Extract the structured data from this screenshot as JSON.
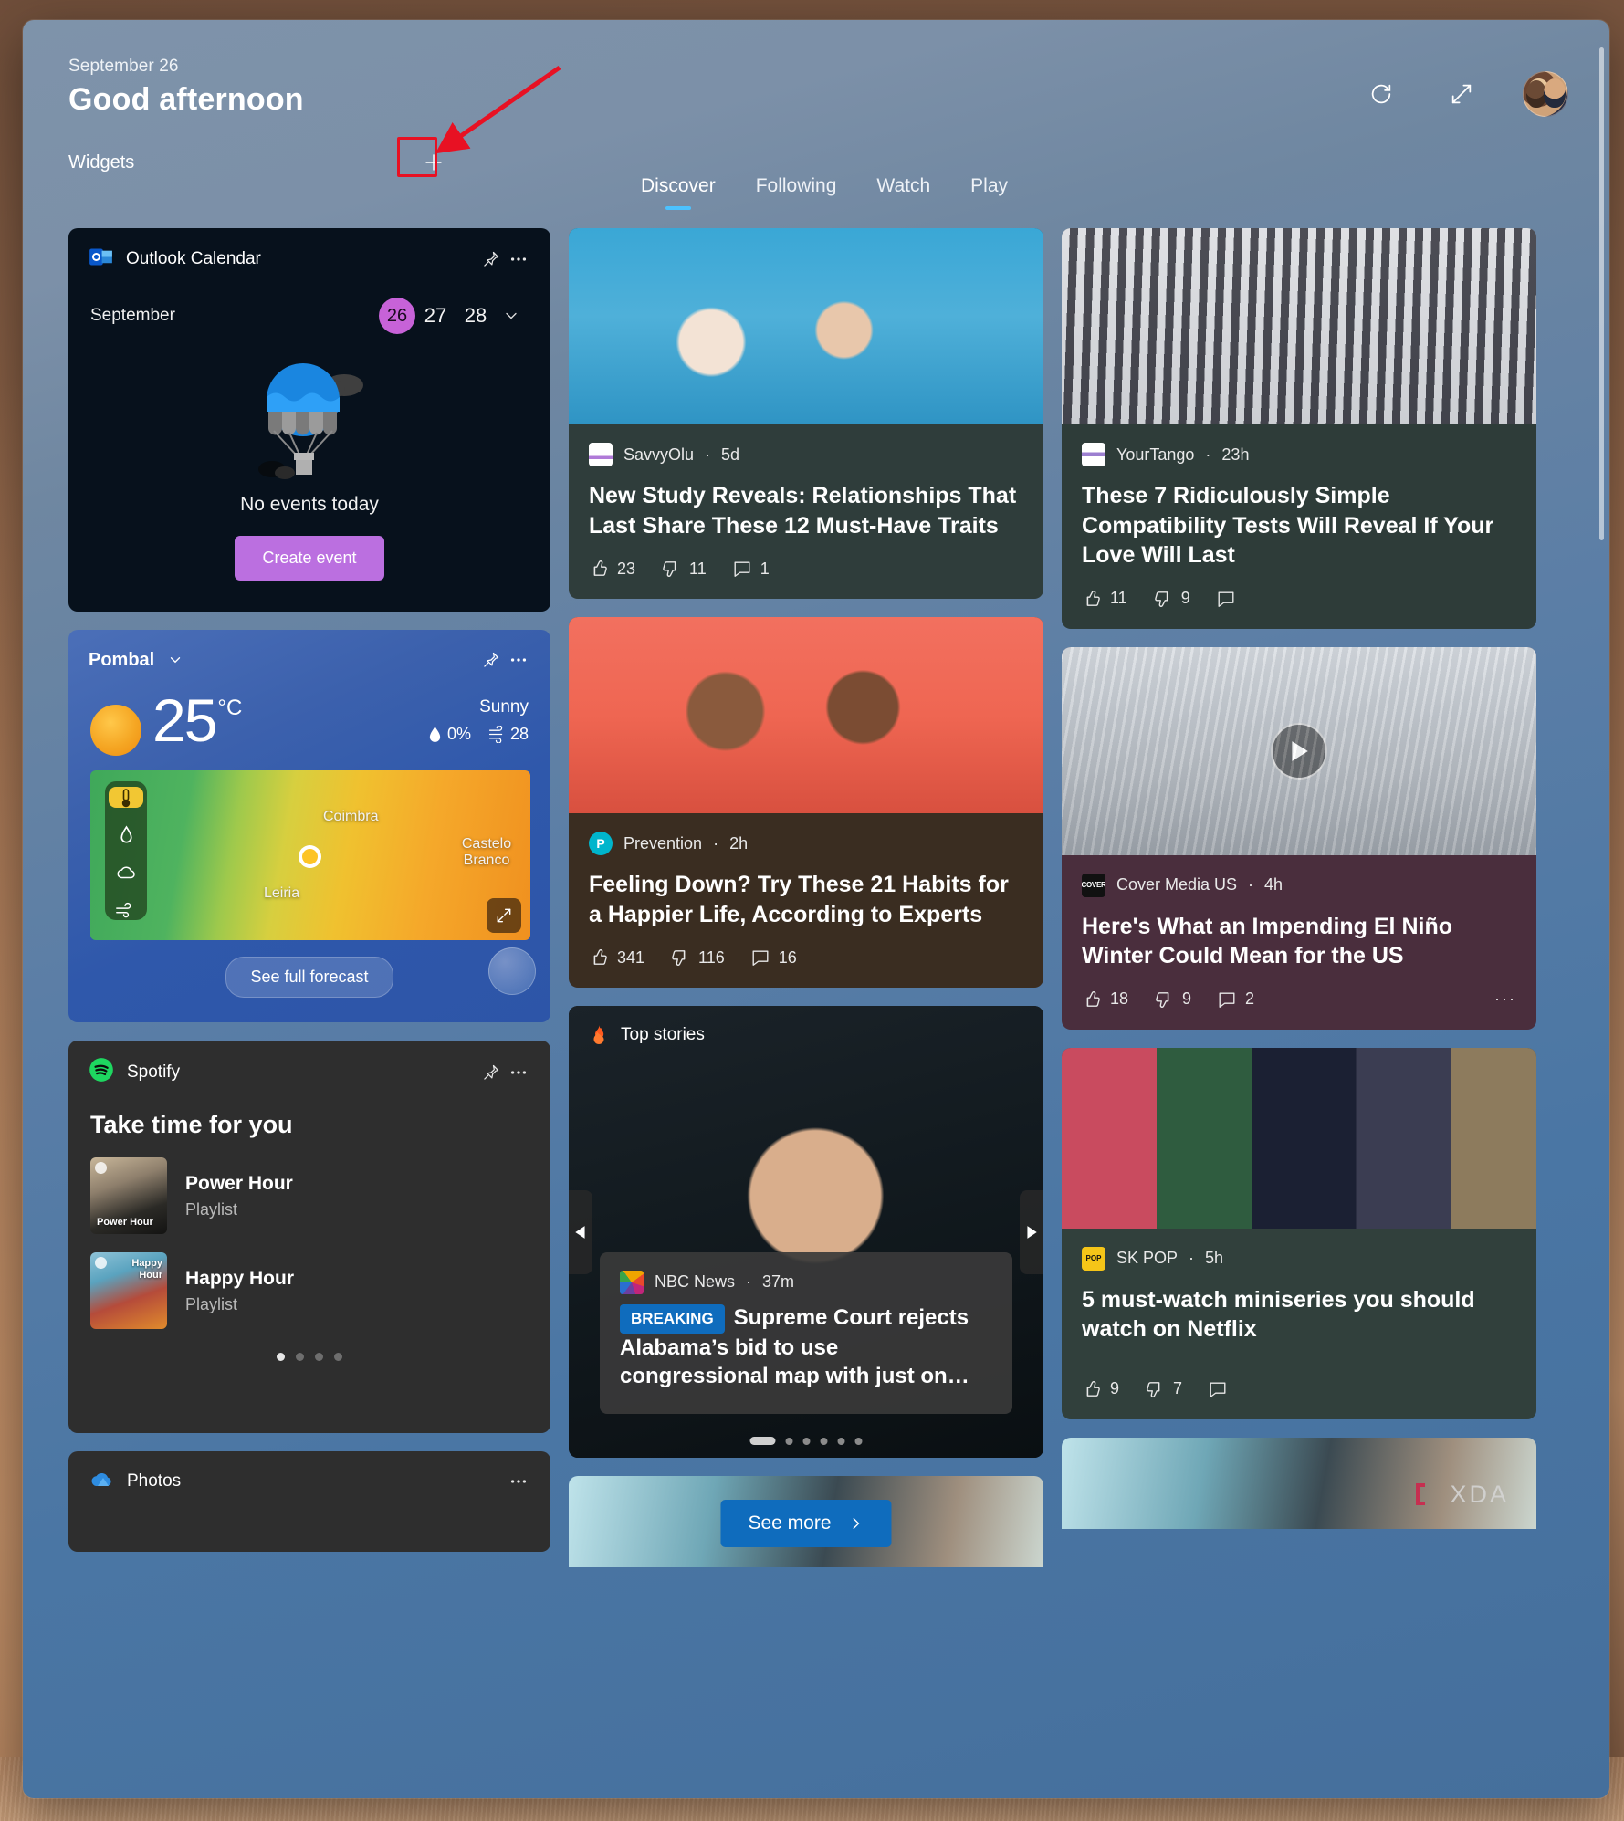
{
  "header": {
    "date": "September 26",
    "greeting": "Good afternoon",
    "widgets_label": "Widgets",
    "add_widget_label": "+",
    "refresh_icon": "refresh-icon",
    "expand_icon": "expand-icon",
    "avatar_icon": "user-avatar"
  },
  "tabs": [
    {
      "label": "Discover",
      "active": true
    },
    {
      "label": "Following",
      "active": false
    },
    {
      "label": "Watch",
      "active": false
    },
    {
      "label": "Play",
      "active": false
    }
  ],
  "widgets": {
    "calendar": {
      "app_name": "Outlook Calendar",
      "month": "September",
      "days": [
        "26",
        "27",
        "28"
      ],
      "selected_day": "26",
      "empty_state": "No events today",
      "create_event_label": "Create event",
      "pin_icon": "pin-icon",
      "more_icon": "more-options-icon",
      "chevron_icon": "chevron-down-icon"
    },
    "weather": {
      "location": "Pombal",
      "temperature": "25",
      "unit": "°C",
      "condition": "Sunny",
      "precipitation": "0%",
      "air_quality": "28",
      "forecast_button": "See full forecast",
      "map_labels": [
        "Coimbra",
        "Leiria",
        "Castelo Branco"
      ],
      "map_layers": [
        "temperature-icon",
        "precipitation-icon",
        "clouds-icon",
        "wind-icon"
      ],
      "active_layer": "temperature-icon",
      "expand_icon": "expand-map-icon",
      "pin_icon": "pin-icon",
      "more_icon": "more-options-icon"
    },
    "spotify": {
      "app_name": "Spotify",
      "heading": "Take time for you",
      "items": [
        {
          "name": "Power Hour",
          "type": "Playlist"
        },
        {
          "name": "Happy Hour",
          "type": "Playlist"
        }
      ],
      "page_count": 4,
      "active_page": 1,
      "pin_icon": "pin-icon",
      "more_icon": "more-options-icon"
    },
    "photos": {
      "app_name": "Photos",
      "more_icon": "more-options-icon"
    }
  },
  "feed": {
    "cards": [
      {
        "source": "SavvyOlu",
        "time": "5d",
        "headline": "New Study Reveals: Relationships That Last Share These 12 Must-Have Traits",
        "likes": "23",
        "dislikes": "11",
        "comments": "1"
      },
      {
        "source": "YourTango",
        "time": "23h",
        "headline": "These 7 Ridiculously Simple Compatibility Tests Will Reveal If Your Love Will Last",
        "likes": "11",
        "dislikes": "9",
        "comments": ""
      },
      {
        "source": "Prevention",
        "time": "2h",
        "headline": "Feeling Down? Try These 21 Habits for a Happier Life, According to Experts",
        "likes": "341",
        "dislikes": "116",
        "comments": "16"
      },
      {
        "source": "Cover Media US",
        "time": "4h",
        "headline": "Here's What an Impending El Niño Winter Could Mean for the US",
        "likes": "18",
        "dislikes": "9",
        "comments": "2"
      },
      {
        "source": "SK POP",
        "time": "5h",
        "headline": "5 must-watch miniseries you should watch on Netflix",
        "likes": "9",
        "dislikes": "7",
        "comments": ""
      }
    ],
    "top_stories": {
      "label": "Top stories",
      "flame_icon": "flame-icon",
      "source": "NBC News",
      "time": "37m",
      "badge": "BREAKING",
      "headline": "Supreme Court rejects Alabama’s bid to use congressional map with just on…",
      "prev_icon": "carousel-prev-icon",
      "next_icon": "carousel-next-icon",
      "page_count": 6,
      "active_page": 1
    },
    "see_more": {
      "label": "See more",
      "chevron_icon": "chevron-right-icon"
    }
  },
  "annotation": {
    "highlight_target": "add-widget-button",
    "color": "#e81123"
  },
  "watermark": "XDA"
}
